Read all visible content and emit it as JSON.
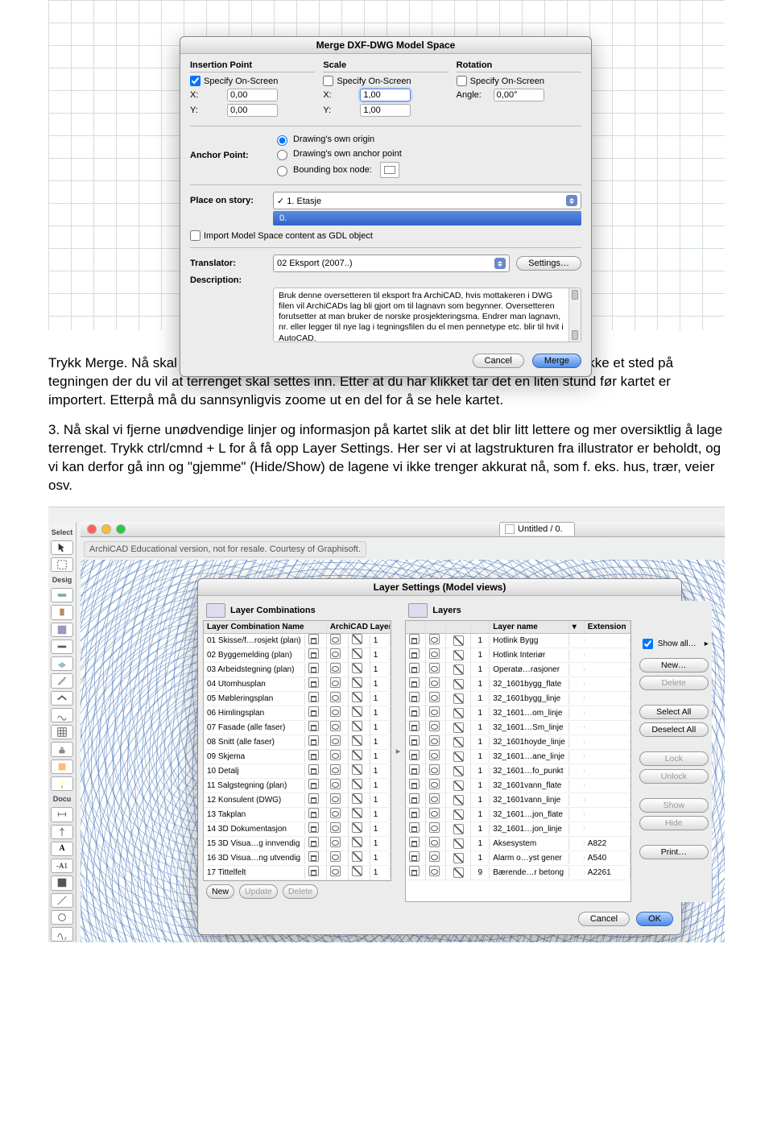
{
  "merge": {
    "title": "Merge DXF-DWG Model Space",
    "sections": {
      "insertion": "Insertion Point",
      "scale": "Scale",
      "rotation": "Rotation"
    },
    "specify": "Specify On-Screen",
    "x": "X:",
    "y": "Y:",
    "angle": "Angle:",
    "ix": "0,00",
    "iy": "0,00",
    "sx": "1,00",
    "sy": "1,00",
    "rAngle": "0,00°",
    "anchor": {
      "label": "Anchor Point:",
      "opt1": "Drawing's own origin",
      "opt2": "Drawing's own anchor point",
      "opt3": "Bounding box node:"
    },
    "storyLabel": "Place on story:",
    "storySel": "✓ 1. Etasje",
    "storyDrop": "0.",
    "gdl": "Import Model Space content as GDL object",
    "translator": {
      "label": "Translator:",
      "value": "02 Eksport (2007..)",
      "settings": "Settings…"
    },
    "descLabel": "Description:",
    "desc": "Bruk denne oversetteren til eksport fra ArchiCAD, hvis mottakeren i DWG filen vil ArchiCADs lag bli gjort om til lagnavn som begynner. Oversetteren forutsetter at man bruker de norske prosjekteringsma. Endrer man lagnavn, nr. eller legger til nye lag i tegningsfilen du el men pennetype etc. blir til hvit i AutoCAD.",
    "cancel": "Cancel",
    "mergeBtn": "Merge"
  },
  "prose1": "Trykk Merge. Nå skal musepekeren ha blitt til en blyant i ArchiCAD. Det betyr at du må klikke et sted på tegningen der du vil at terrenget skal settes inn. Etter at du har klikket tar det en liten stund før kartet er importert. Etterpå må du sannsynligvis zoome ut en del for å se hele kartet.",
  "prose2": "3. Nå skal vi fjerne unødvendige linjer og informasjon på kartet slik at det blir litt lettere og mer oversiktlig å lage terrenget. Trykk ctrl/cmnd + L for å få opp Layer Settings. Her ser vi at lagstrukturen fra illustrator er beholdt, og vi kan derfor gå inn og \"gjemme\" (Hide/Show) de lagene vi ikke trenger akkurat nå, som f. eks. hus, trær, veier osv.",
  "win": {
    "tab": "Untitled / 0.",
    "edu": "ArchiCAD Educational version, not for resale. Courtesy of Graphisoft."
  },
  "toolbox": {
    "select": "Select",
    "desig": "Desig",
    "docu": "Docu"
  },
  "ls": {
    "title": "Layer Settings (Model views)",
    "lcHead": "Layer Combinations",
    "lyHead": "Layers",
    "lcCols": {
      "name": "Layer Combination Name",
      "al": "ArchiCAD Layer"
    },
    "lyCols": {
      "name": "Layer name",
      "ext": "Extension"
    },
    "showAll": "Show all…",
    "lcRows": [
      {
        "n": "01 Skisse/f…rosjekt (plan)",
        "v": "1"
      },
      {
        "n": "02 Byggemelding (plan)",
        "v": "1"
      },
      {
        "n": "03 Arbeidstegning (plan)",
        "v": "1"
      },
      {
        "n": "04 Utomhusplan",
        "v": "1"
      },
      {
        "n": "05 Møbleringsplan",
        "v": "1"
      },
      {
        "n": "06 Himlingsplan",
        "v": "1"
      },
      {
        "n": "07 Fasade (alle faser)",
        "v": "1"
      },
      {
        "n": "08 Snitt (alle faser)",
        "v": "1"
      },
      {
        "n": "09 Skjema",
        "v": "1"
      },
      {
        "n": "10 Detalj",
        "v": "1"
      },
      {
        "n": "11 Salgstegning (plan)",
        "v": "1"
      },
      {
        "n": "12 Konsulent (DWG)",
        "v": "1"
      },
      {
        "n": "13 Takplan",
        "v": "1"
      },
      {
        "n": "14 3D Dokumentasjon",
        "v": "1"
      },
      {
        "n": "15 3D Visua…g innvendig",
        "v": "1"
      },
      {
        "n": "16 3D Visua…ng utvendig",
        "v": "1"
      },
      {
        "n": "17 Tittelfelt",
        "v": "1"
      }
    ],
    "lyRows": [
      {
        "p": "1",
        "n": "Hotlink Bygg",
        "e": ""
      },
      {
        "p": "1",
        "n": "Hotlink Interiør",
        "e": ""
      },
      {
        "p": "1",
        "n": "Operatø…rasjoner",
        "e": ""
      },
      {
        "p": "1",
        "n": "32_1601bygg_flate",
        "e": ""
      },
      {
        "p": "1",
        "n": "32_1601bygg_linje",
        "e": ""
      },
      {
        "p": "1",
        "n": "32_1601…om_linje",
        "e": ""
      },
      {
        "p": "1",
        "n": "32_1601…Sm_linje",
        "e": ""
      },
      {
        "p": "1",
        "n": "32_1601hoyde_linje",
        "e": ""
      },
      {
        "p": "1",
        "n": "32_1601…ane_linje",
        "e": ""
      },
      {
        "p": "1",
        "n": "32_1601…fo_punkt",
        "e": ""
      },
      {
        "p": "1",
        "n": "32_1601vann_flate",
        "e": ""
      },
      {
        "p": "1",
        "n": "32_1601vann_linje",
        "e": ""
      },
      {
        "p": "1",
        "n": "32_1601…jon_flate",
        "e": ""
      },
      {
        "p": "1",
        "n": "32_1601…jon_linje",
        "e": ""
      },
      {
        "p": "1",
        "n": "Aksesystem",
        "e": "A822"
      },
      {
        "p": "1",
        "n": "Alarm o…yst gener",
        "e": "A540"
      },
      {
        "p": "9",
        "n": "Bærende…r betong",
        "e": "A2261"
      }
    ],
    "btns": {
      "new": "New",
      "update": "Update",
      "delete": "Delete",
      "newR": "New…",
      "delR": "Delete",
      "selAll": "Select All",
      "deselAll": "Deselect All",
      "lock": "Lock",
      "unlock": "Unlock",
      "show": "Show",
      "hide": "Hide",
      "print": "Print…",
      "cancel": "Cancel",
      "ok": "OK"
    }
  }
}
